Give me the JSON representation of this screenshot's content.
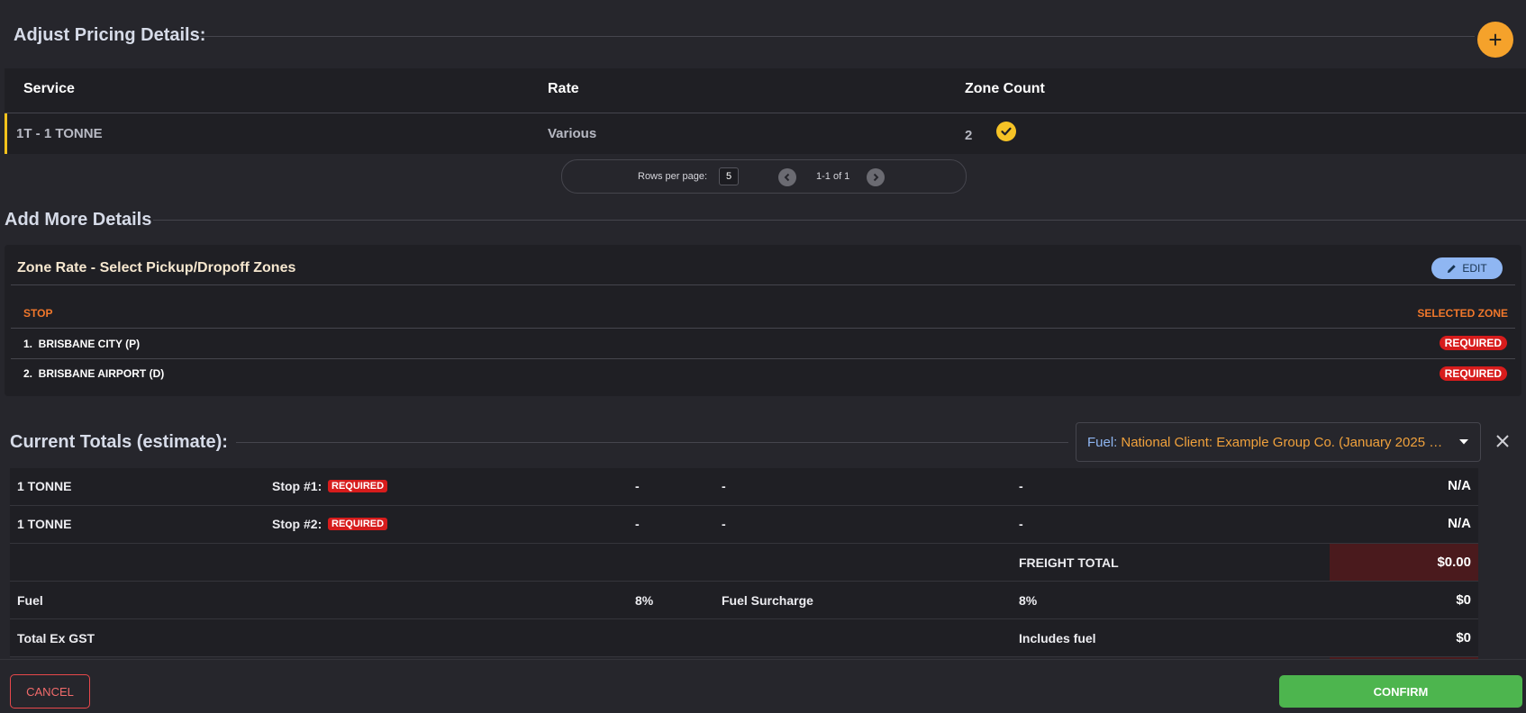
{
  "pricing": {
    "title": "Adjust Pricing Details:",
    "add_icon": "plus-icon",
    "columns": [
      "Service",
      "Rate",
      "Zone Count"
    ],
    "row": {
      "service": "1T - 1 TONNE",
      "rate": "Various",
      "zone_count": "2",
      "status_icon": "check-circle-icon"
    },
    "pager": {
      "rows_per_page_label": "Rows per page:",
      "rows_per_page": "5",
      "range": "1-1 of 1"
    }
  },
  "more_details": {
    "title": "Add More Details",
    "zone_rate_title": "Zone Rate - Select Pickup/Dropoff Zones",
    "edit_label": "EDIT",
    "stop_header": "STOP",
    "zone_header": "SELECTED ZONE",
    "stops": [
      {
        "label": "1.  BRISBANE CITY (P)",
        "zone": "REQUIRED"
      },
      {
        "label": "2.  BRISBANE AIRPORT (D)",
        "zone": "REQUIRED"
      }
    ]
  },
  "totals": {
    "title": "Current Totals (estimate):",
    "fuel_label": "Fuel:",
    "fuel_value": "National Client: Example Group Co. (January 2025 - ...",
    "rows": [
      {
        "service": "1 TONNE",
        "stop": "Stop #1:",
        "badge": "REQUIRED",
        "c3": "-",
        "c4": "-",
        "c5": "-",
        "amount": "N/A"
      },
      {
        "service": "1 TONNE",
        "stop": "Stop #2:",
        "badge": "REQUIRED",
        "c3": "-",
        "c4": "-",
        "c5": "-",
        "amount": "N/A"
      }
    ],
    "freight_label": "FREIGHT TOTAL",
    "freight_amount": "$0.00",
    "fuel_row": {
      "label": "Fuel",
      "pct": "8%",
      "surcharge_label": "Fuel Surcharge",
      "pct2": "8%",
      "amount": "$0"
    },
    "ex_gst_row": {
      "label": "Total Ex GST",
      "note": "Includes fuel",
      "amount": "$0"
    }
  },
  "footer": {
    "cancel": "CANCEL",
    "confirm": "CONFIRM"
  },
  "colors": {
    "accent": "#f5a22b",
    "required": "#d71c1c",
    "confirm": "#4db54e",
    "edit": "#8fb6f2"
  }
}
